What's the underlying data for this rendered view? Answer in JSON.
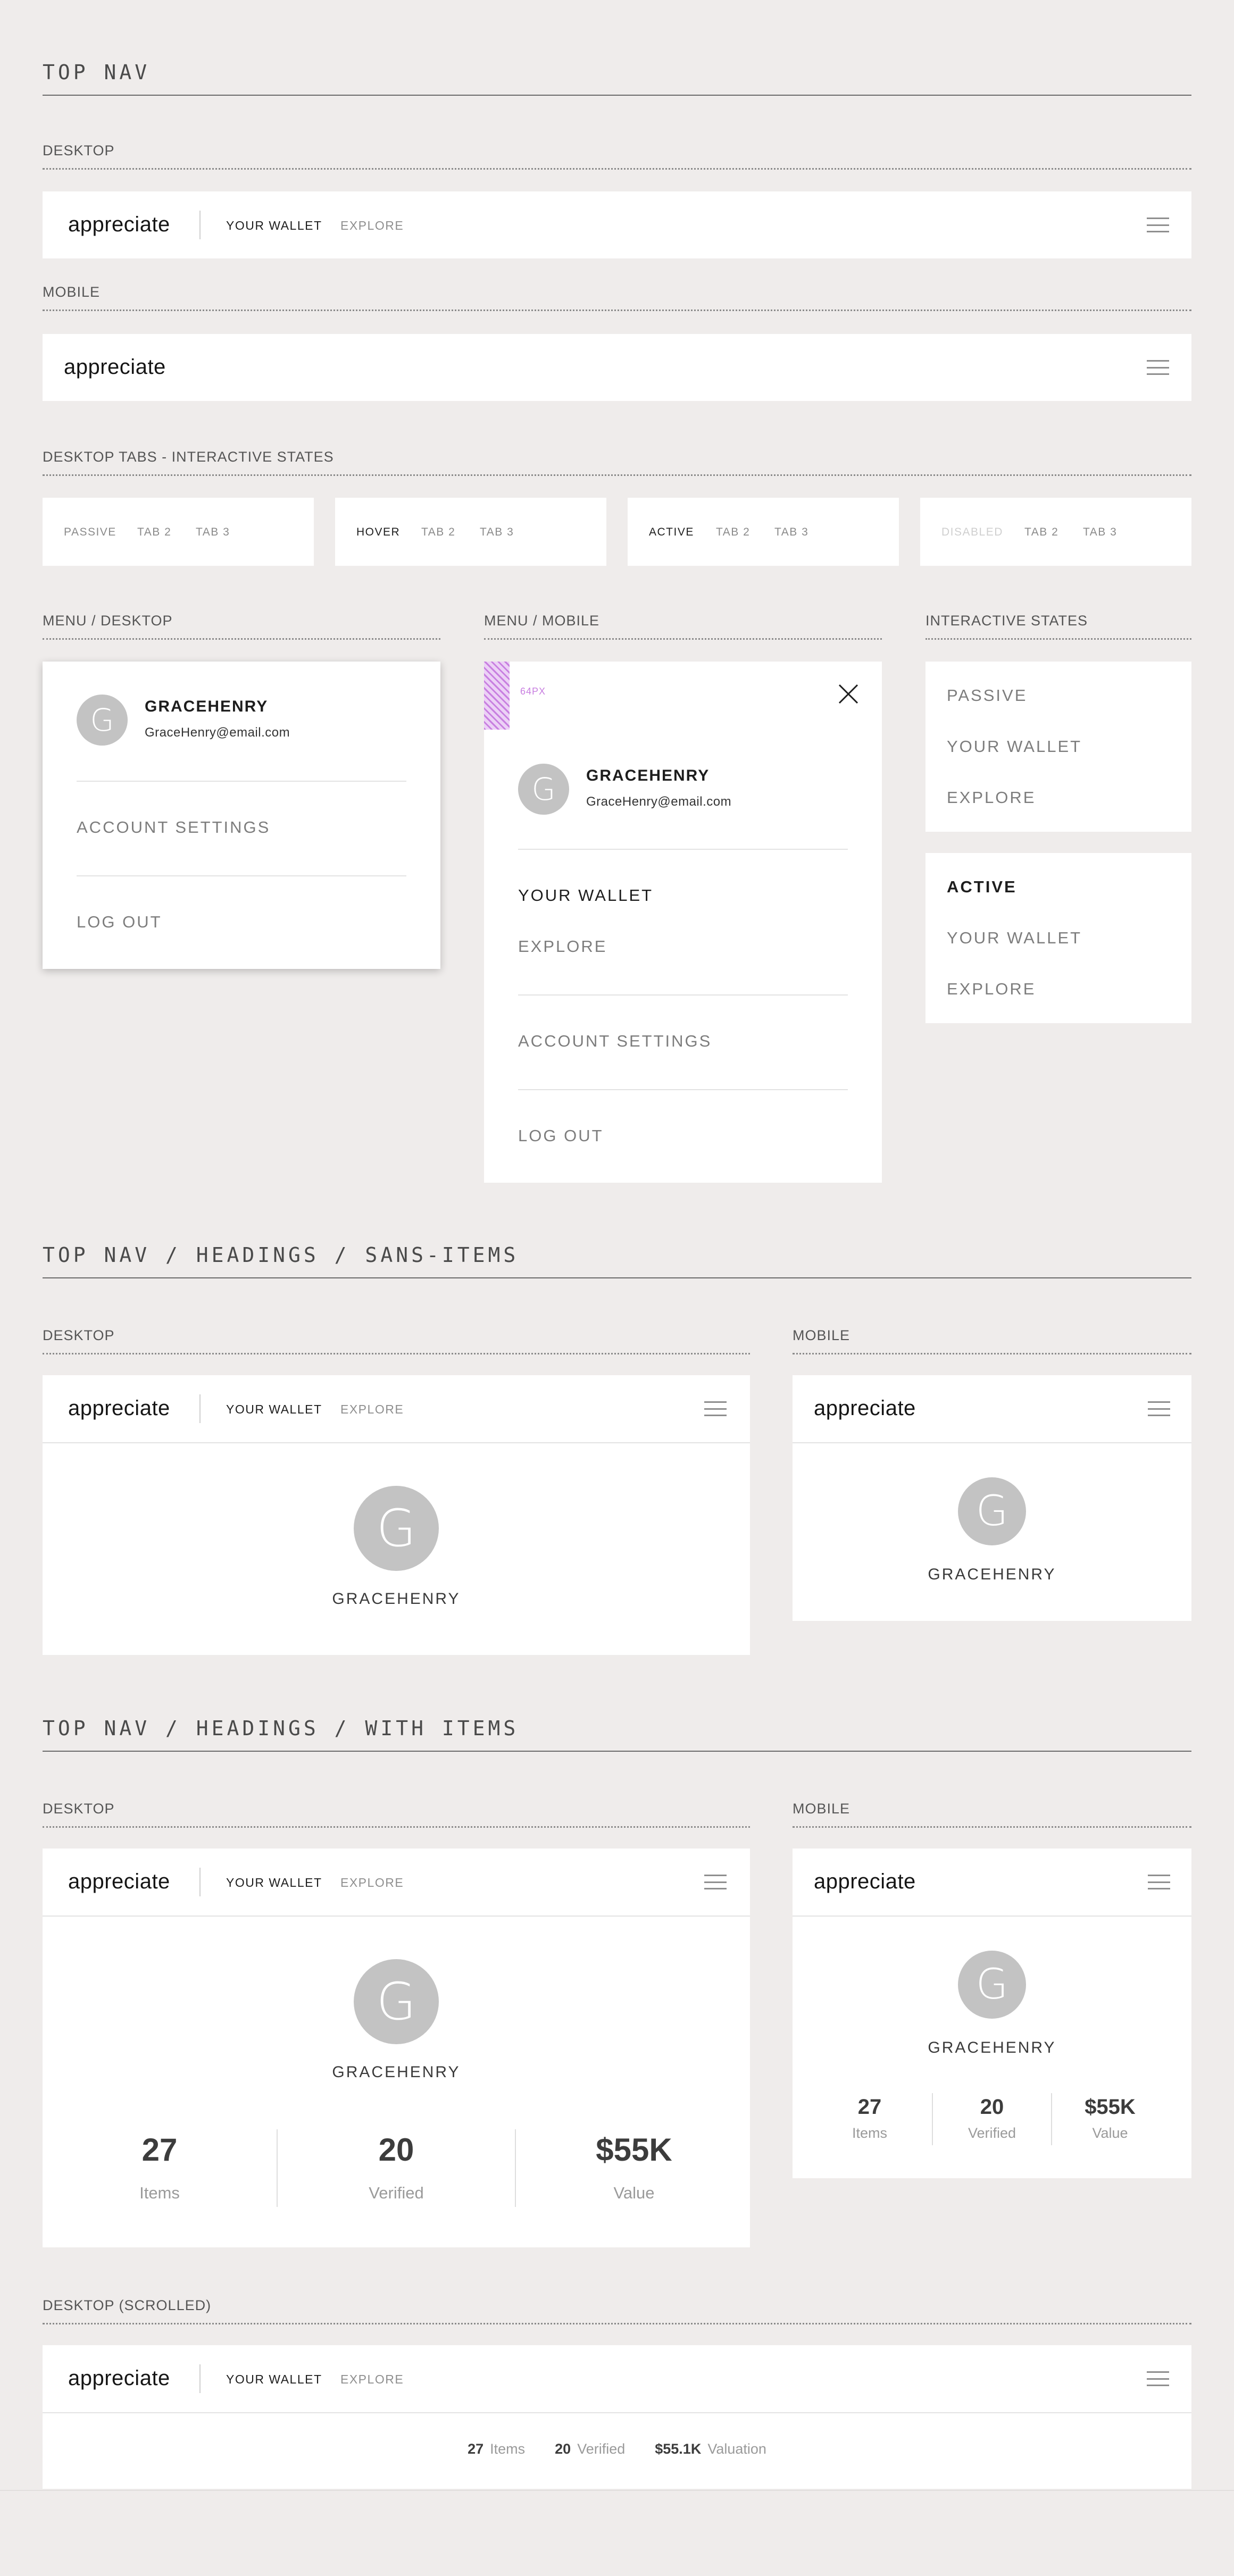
{
  "sections": {
    "top_nav": "TOP NAV",
    "headings_sans": "TOP NAV / HEADINGS / SANS-ITEMS",
    "headings_with": "TOP NAV / HEADINGS / WITH ITEMS"
  },
  "labels": {
    "desktop": "DESKTOP",
    "mobile": "MOBILE",
    "tabs_states": "DESKTOP TABS - INTERACTIVE STATES",
    "menu_desktop": "MENU / DESKTOP",
    "menu_mobile": "MENU / MOBILE",
    "interactive_states": "INTERACTIVE STATES",
    "desktop_scrolled": "DESKTOP (SCROLLED)"
  },
  "nav": {
    "logo": "appreciate",
    "link_wallet": "YOUR WALLET",
    "link_explore": "EXPLORE"
  },
  "tabs": [
    {
      "state": "PASSIVE",
      "tab2": "TAB 2",
      "tab3": "TAB 3"
    },
    {
      "state": "HOVER",
      "tab2": "TAB 2",
      "tab3": "TAB 3"
    },
    {
      "state": "ACTIVE",
      "tab2": "TAB 2",
      "tab3": "TAB 3"
    },
    {
      "state": "DISABLED",
      "tab2": "TAB 2",
      "tab3": "TAB 3"
    }
  ],
  "user": {
    "initial": "G",
    "name": "GRACEHENRY",
    "email": "GraceHenry@email.com"
  },
  "menu": {
    "account_settings": "ACCOUNT SETTINGS",
    "log_out": "LOG OUT",
    "your_wallet": "YOUR WALLET",
    "explore": "EXPLORE",
    "spacing_note": "64PX"
  },
  "states": {
    "passive": "PASSIVE",
    "active": "ACTIVE",
    "your_wallet": "YOUR WALLET",
    "explore": "EXPLORE"
  },
  "stats": {
    "items_value": "27",
    "items_label": "Items",
    "verified_value": "20",
    "verified_label": "Verified",
    "value_value": "$55K",
    "value_label": "Value",
    "valuation_value": "$55.1K",
    "valuation_label": "Valuation"
  },
  "colors": {
    "background": "#efeceb",
    "card": "#ffffff",
    "avatar": "#c3c3c3",
    "spacing_marker": "#c87fe0"
  },
  "icons": {
    "menu": "hamburger-icon",
    "close": "close-icon"
  }
}
